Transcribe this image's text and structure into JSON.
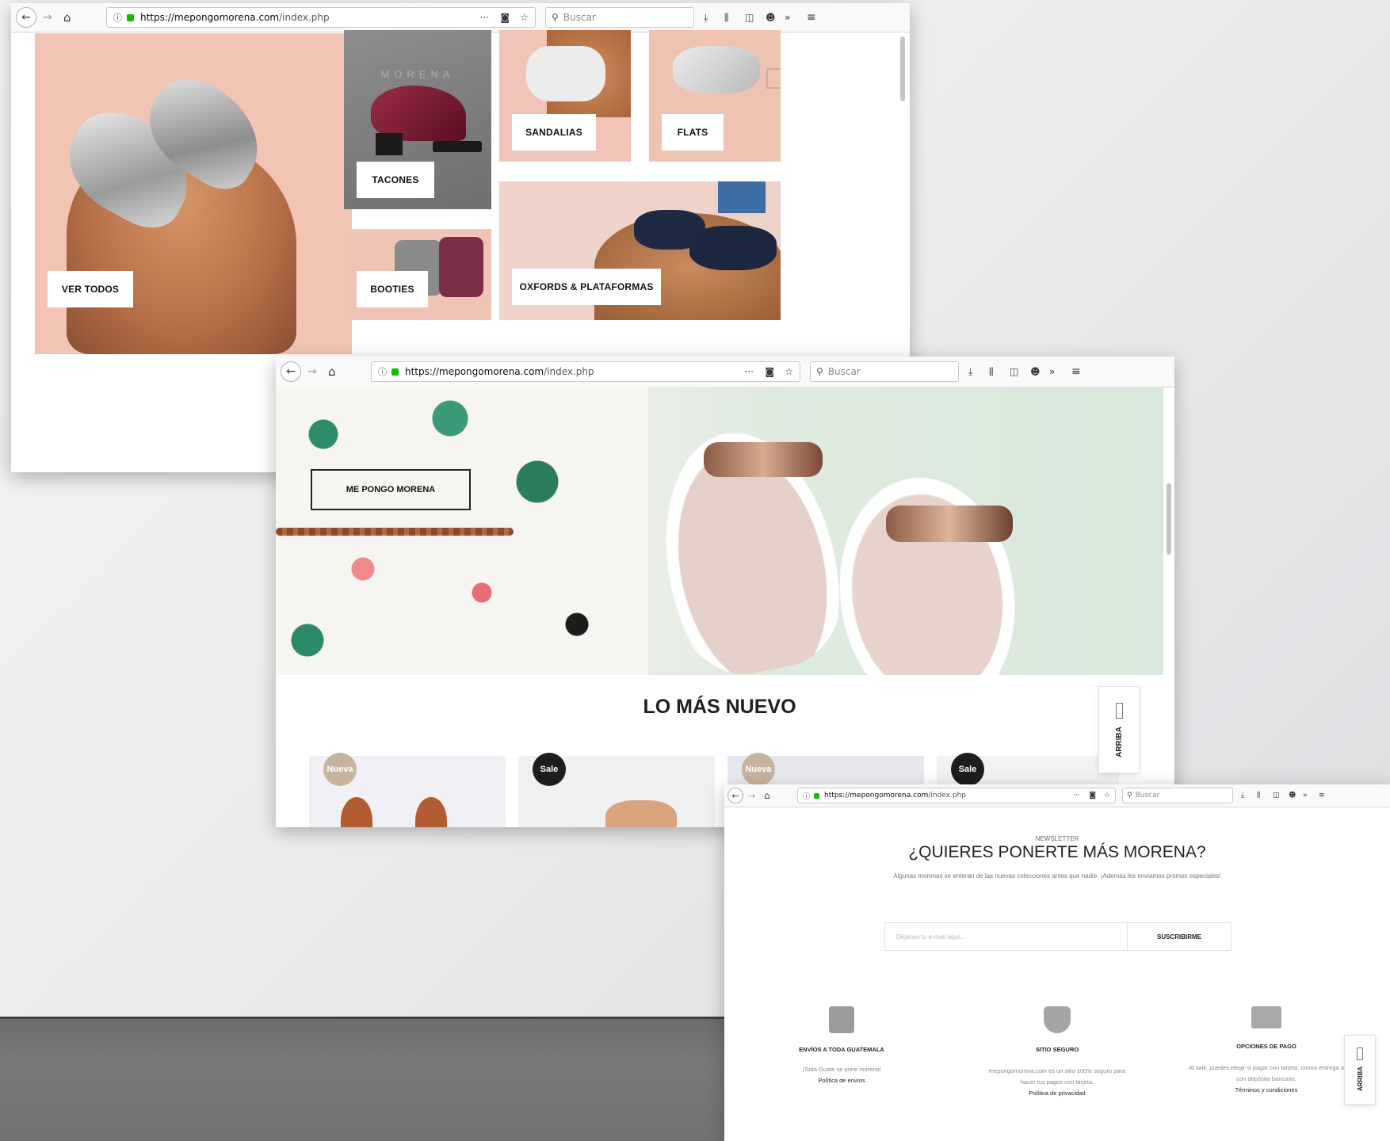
{
  "browser": {
    "url_host": "https://mepongomorena.com",
    "url_path": "/index.php",
    "search_placeholder": "Buscar"
  },
  "page1": {
    "tiles": [
      {
        "label": "VER TODOS"
      },
      {
        "label": "TACONES",
        "brand": "MORENA"
      },
      {
        "label": "SANDALIAS"
      },
      {
        "label": "FLATS"
      },
      {
        "label": "BOOTIES"
      },
      {
        "label": "OXFORDS & PLATAFORMAS"
      }
    ]
  },
  "page2": {
    "hero_button": "ME PONGO MORENA",
    "section_title": "LO MÁS NUEVO",
    "scroll_top_label": "ARRIBA",
    "badges": [
      "Nueva",
      "Sale",
      "Nueva",
      "Sale"
    ]
  },
  "page3": {
    "kicker": "NEWSLETTER",
    "title": "¿QUIERES PONERTE MÁS MORENA?",
    "subtitle": "Algunas morenas se enteran de las nuevas colecciones antes que nadie. ¡Además les enviamos promos especiales!",
    "email_placeholder": "Déjanos tu e-mail aquí...",
    "subscribe_label": "SUSCRIBIRME",
    "scroll_top_label": "ARRIBA",
    "features": [
      {
        "icon": "shipping-box-icon",
        "title": "ENVÍOS A TODA GUATEMALA",
        "text": "¡Toda Guate se pone morena!",
        "link": "Política de envíos"
      },
      {
        "icon": "secure-shield-icon",
        "title": "SITIO SEGURO",
        "text": "mepongomorena.com es un sitio 100% seguro para hacer tus pagos con tarjeta.",
        "link": "Política de privacidad"
      },
      {
        "icon": "delivery-truck-icon",
        "title": "OPCIONES DE PAGO",
        "text": "Al salir, puedes elegir si pagar con tarjeta, contra entrega o con depósito bancario.",
        "link": "Términos y condiciones"
      }
    ]
  },
  "colors": {
    "badge_new": "#c7b3a0",
    "badge_sale": "#1d1d1d",
    "lock_green": "#12bc00"
  }
}
